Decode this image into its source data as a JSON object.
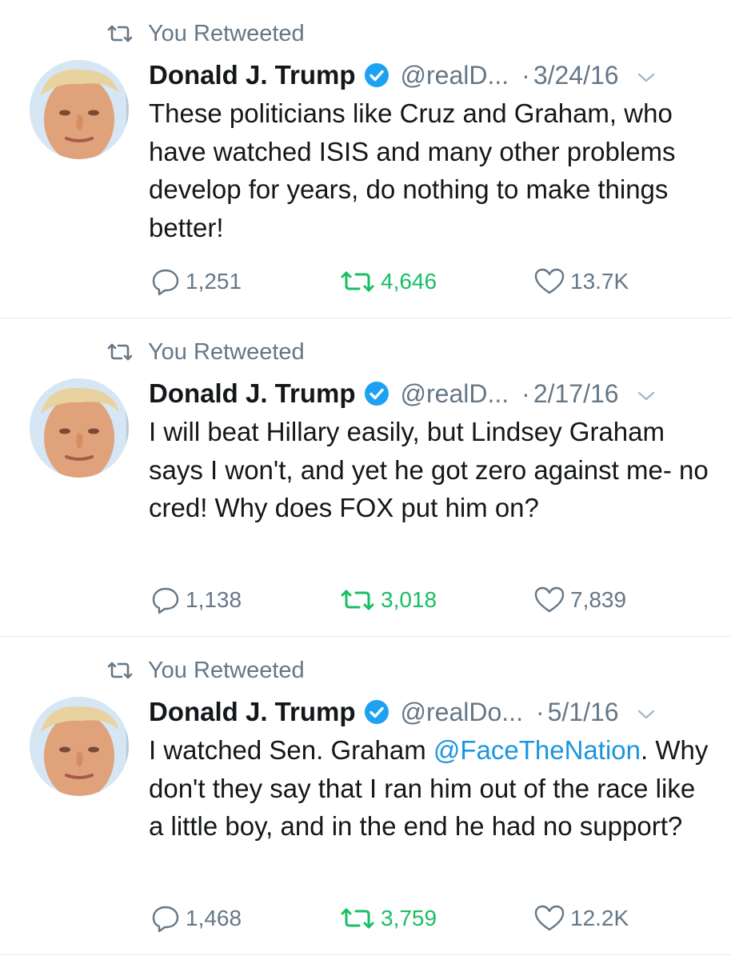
{
  "colors": {
    "text": "#14171a",
    "secondary": "#657786",
    "retweet_green": "#17bf63",
    "link_blue": "#1b95e0",
    "verified_blue": "#1da1f2",
    "divider": "#e1e8ed"
  },
  "icons": {
    "retweet": "retweet-icon",
    "reply": "reply-bubble-icon",
    "like": "heart-icon",
    "verified": "verified-badge-icon",
    "more": "chevron-down-icon"
  },
  "tweets": [
    {
      "retweet_label": "You Retweeted",
      "author_name": "Donald J. Trump",
      "handle": "@realD...",
      "separator": "·",
      "date": "3/24/16",
      "text_before": "These politicians like Cruz and Graham, who have watched ISIS and many other problems develop for years, do nothing to make things better!",
      "mention": "",
      "text_after": "",
      "replies": "1,251",
      "retweets": "4,646",
      "likes": "13.7K"
    },
    {
      "retweet_label": "You Retweeted",
      "author_name": "Donald J. Trump",
      "handle": "@realD...",
      "separator": "·",
      "date": "2/17/16",
      "text_before": "I will beat Hillary easily, but Lindsey Graham says I won't, and yet he got zero against me- no cred! Why does FOX put him on?",
      "mention": "",
      "text_after": "",
      "replies": "1,138",
      "retweets": "3,018",
      "likes": "7,839"
    },
    {
      "retweet_label": "You Retweeted",
      "author_name": "Donald J. Trump",
      "handle": "@realDo...",
      "separator": "·",
      "date": "5/1/16",
      "text_before": "I watched Sen. Graham ",
      "mention": "@FaceTheNation",
      "text_after": ". Why don't they say that I ran him out of the race like a little boy, and in the end he had no support?",
      "replies": "1,468",
      "retweets": "3,759",
      "likes": "12.2K"
    }
  ]
}
